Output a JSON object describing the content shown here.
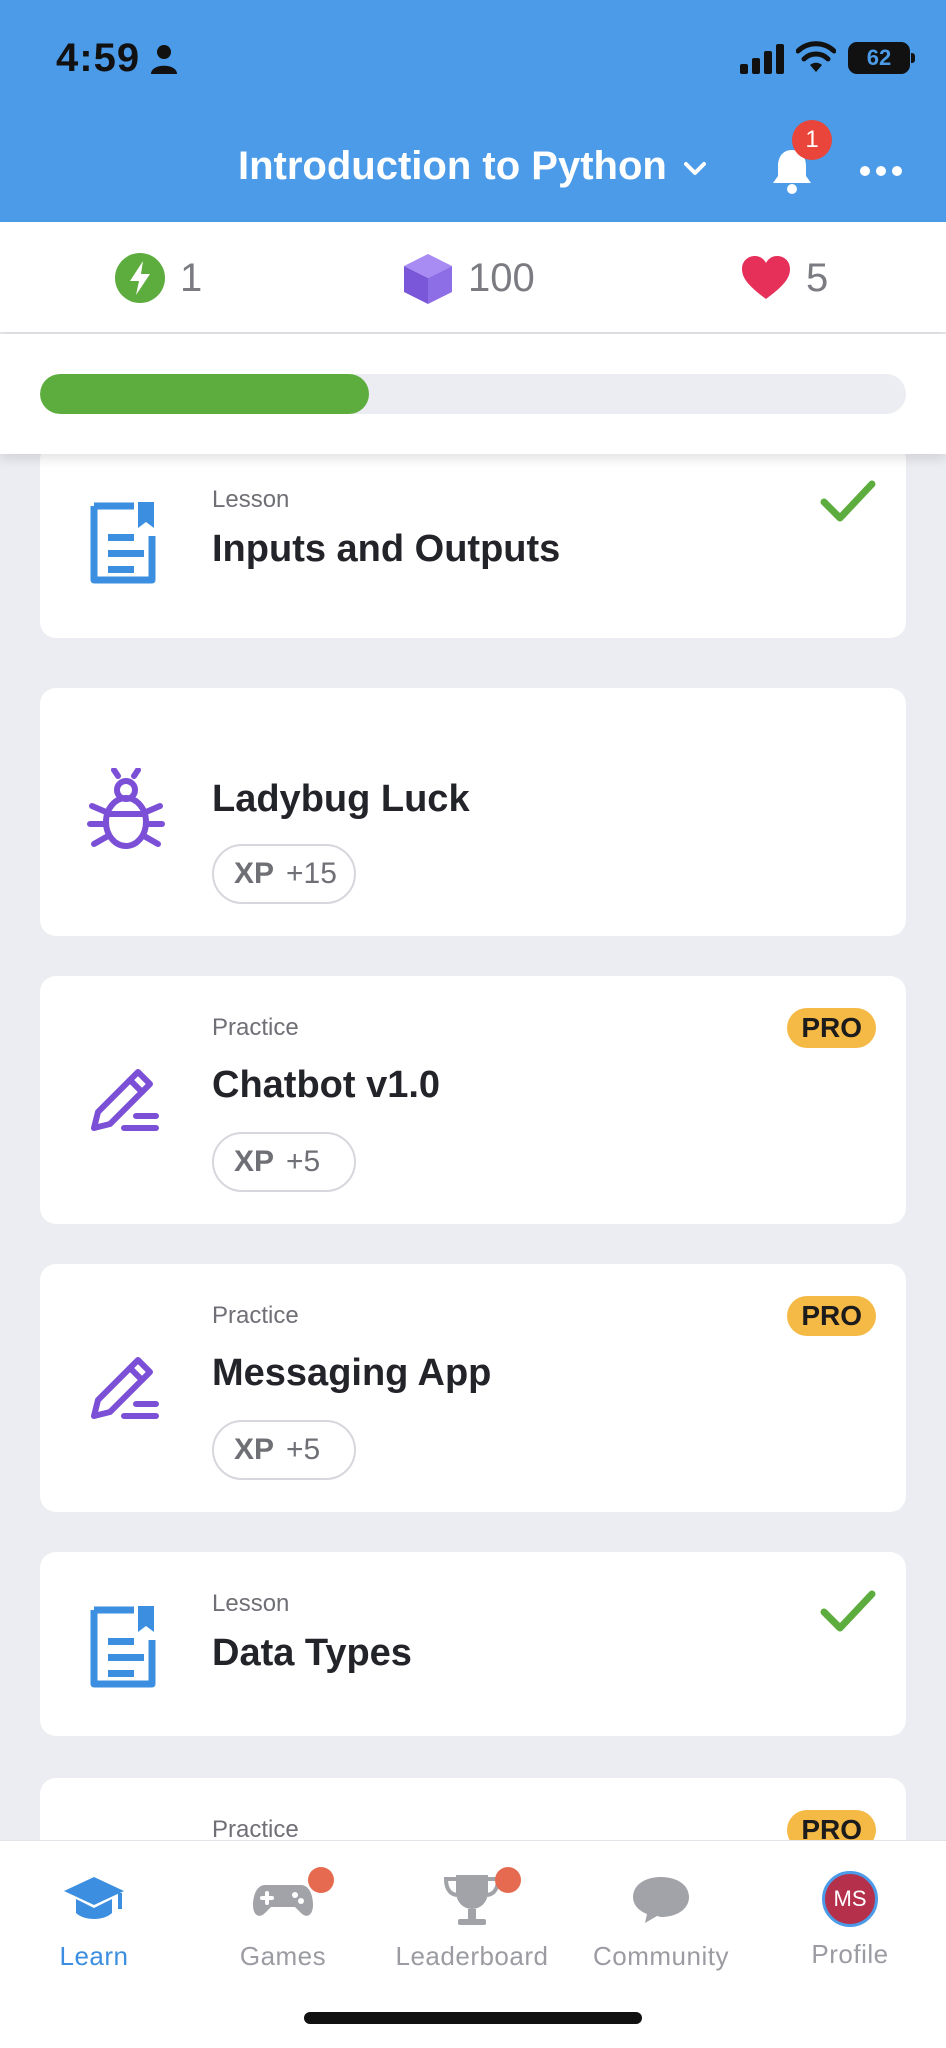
{
  "status_bar": {
    "time": "4:59",
    "battery": "62"
  },
  "header": {
    "title": "Introduction to Python",
    "notification_count": "1"
  },
  "stats": {
    "streak": "1",
    "gems": "100",
    "hearts": "5"
  },
  "progress": {
    "fraction": 0.38
  },
  "cards": [
    {
      "type": "Lesson",
      "title": "Inputs and Outputs",
      "completed": true,
      "icon": "lesson-icon"
    },
    {
      "type": "",
      "title": "Ladybug Luck",
      "xp_label": "XP",
      "xp_value": "+15",
      "icon": "bug-icon"
    },
    {
      "type": "Practice",
      "title": "Chatbot v1.0",
      "xp_label": "XP",
      "xp_value": "+5",
      "pro": "PRO",
      "icon": "practice-icon"
    },
    {
      "type": "Practice",
      "title": "Messaging App",
      "xp_label": "XP",
      "xp_value": "+5",
      "pro": "PRO",
      "icon": "practice-icon"
    },
    {
      "type": "Lesson",
      "title": "Data Types",
      "completed": true,
      "icon": "lesson-icon"
    },
    {
      "type": "Practice",
      "title": "",
      "pro": "PRO",
      "icon": "practice-icon"
    }
  ],
  "tabs": [
    {
      "label": "Learn",
      "active": true,
      "icon": "graduation-cap-icon"
    },
    {
      "label": "Games",
      "icon": "gamepad-icon",
      "dot": true
    },
    {
      "label": "Leaderboard",
      "icon": "trophy-icon",
      "dot": true
    },
    {
      "label": "Community",
      "icon": "chat-bubble-icon"
    },
    {
      "label": "Profile",
      "icon": "avatar",
      "avatar_initials": "MS"
    }
  ],
  "colors": {
    "header_blue": "#4b9be8",
    "progress_green": "#5dad3e",
    "pro_yellow": "#f5b945",
    "lesson_blue": "#3c8fe0",
    "practice_purple": "#7b4fd6",
    "check_green": "#5dad3e",
    "heart_red": "#e6305a"
  }
}
